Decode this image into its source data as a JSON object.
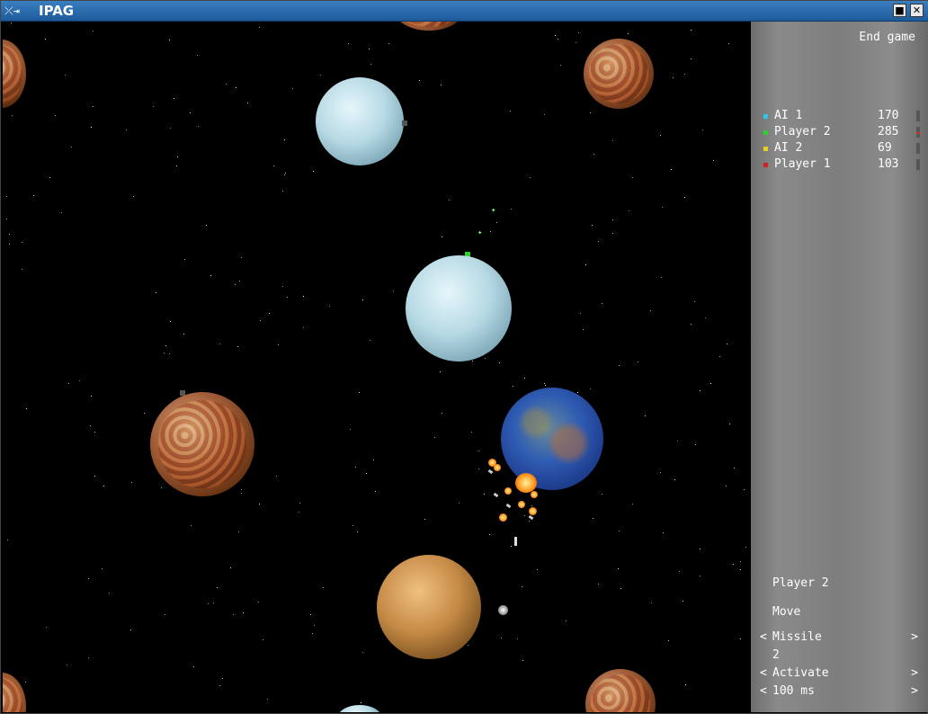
{
  "window": {
    "title": "IPAG",
    "system_icon": "⤫⇥"
  },
  "panel": {
    "end_game_label": "End game",
    "scores": [
      {
        "name": "AI 1",
        "score": "170",
        "color": "#28c8e8"
      },
      {
        "name": "Player 2",
        "score": "285",
        "color": "#30d030",
        "bar_level": "low"
      },
      {
        "name": "AI 2",
        "score": "69",
        "color": "#e8d020"
      },
      {
        "name": "Player 1",
        "score": "103",
        "color": "#d02020"
      }
    ],
    "current_player": "Player 2",
    "action": "Move",
    "weapon": {
      "prev": "<",
      "label": "Missile",
      "next": ">"
    },
    "weapon_count": "2",
    "mode": {
      "prev": "<",
      "label": "Activate",
      "next": ">"
    },
    "delay": {
      "prev": "<",
      "label": "100 ms",
      "next": ">"
    }
  },
  "icons": {
    "minimize": "■",
    "close": "✕"
  }
}
